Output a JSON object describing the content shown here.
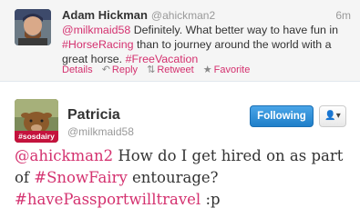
{
  "reply_tweet": {
    "name": "Adam Hickman",
    "handle": "@ahickman2",
    "time": "6m",
    "text": {
      "mention": "@milkmaid58",
      "part1": " Definitely. What better way to have fun in ",
      "hashtag1": "#HorseRacing",
      "part2": " than to journey around the world with a great horse. ",
      "hashtag2": "#FreeVacation"
    },
    "actions": [
      {
        "label": "Details",
        "icon": ""
      },
      {
        "label": "Reply",
        "icon": "reply-icon"
      },
      {
        "label": "Retweet",
        "icon": "retweet-icon"
      },
      {
        "label": "Favorite",
        "icon": "star-icon"
      }
    ]
  },
  "main_tweet": {
    "name": "Patricia",
    "handle": "@milkmaid58",
    "avatar_tag": "#sosdairy",
    "follow_label": "Following",
    "more_icon": "user-dropdown-icon",
    "text": {
      "mention": "@ahickman2",
      "part1": " How do I get hired on as part of ",
      "hashtag1": "#SnowFairy",
      "part2": " entourage? ",
      "hashtag2": "#havePassportwilltravel",
      "part3": " :p"
    }
  },
  "colors": {
    "link": "#d4316f",
    "follow_button": "#2f8fd6"
  }
}
